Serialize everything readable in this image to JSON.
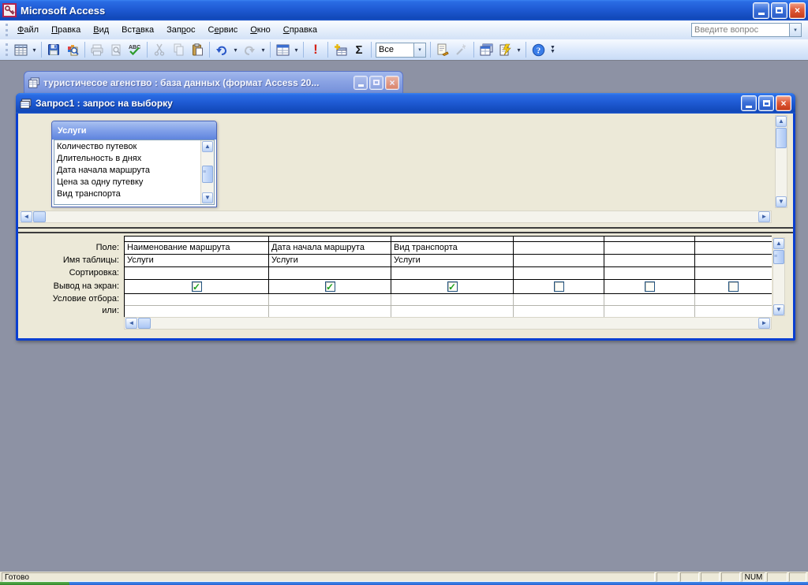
{
  "app": {
    "title": "Microsoft Access"
  },
  "menu": {
    "items": [
      {
        "pre": "",
        "key": "Ф",
        "post": "айл"
      },
      {
        "pre": "",
        "key": "П",
        "post": "равка"
      },
      {
        "pre": "",
        "key": "В",
        "post": "ид"
      },
      {
        "pre": "Вст",
        "key": "а",
        "post": "вка"
      },
      {
        "pre": "Зап",
        "key": "р",
        "post": "ос"
      },
      {
        "pre": "С",
        "key": "е",
        "post": "рвис"
      },
      {
        "pre": "",
        "key": "О",
        "post": "кно"
      },
      {
        "pre": "",
        "key": "С",
        "post": "правка"
      }
    ]
  },
  "question_box": {
    "placeholder": "Введите вопрос"
  },
  "toolbar": {
    "top_values_value": "Все"
  },
  "db_window": {
    "title": "туристичесое агенство : база данных (формат Access 20..."
  },
  "query_window": {
    "title": "Запрос1 : запрос на выборку"
  },
  "field_list": {
    "title": "Услуги",
    "fields": [
      "Количество путевок",
      "Длительность в днях",
      "Дата начала маршрута",
      "Цена за одну путевку",
      "Вид транспорта"
    ]
  },
  "grid": {
    "row_labels": {
      "field": "Поле:",
      "table": "Имя таблицы:",
      "sort": "Сортировка:",
      "show": "Вывод на экран:",
      "criteria": "Условие отбора:",
      "or": "или:"
    },
    "columns": [
      {
        "field": "Наименование маршрута",
        "table": "Услуги",
        "show": true
      },
      {
        "field": "Дата начала маршрута",
        "table": "Услуги",
        "show": true
      },
      {
        "field": "Вид транспорта",
        "table": "Услуги",
        "show": true
      },
      {
        "field": "",
        "table": "",
        "show": false
      },
      {
        "field": "",
        "table": "",
        "show": false
      },
      {
        "field": "",
        "table": "",
        "show": false
      }
    ]
  },
  "status": {
    "ready": "Готово",
    "num": "NUM"
  },
  "icons": {
    "check": "✓",
    "dropdown": "▾",
    "up": "▲",
    "down": "▼",
    "left": "◄",
    "right": "►",
    "close": "×",
    "spell": "ABC",
    "sigma": "Σ",
    "run": "!",
    "help": "?"
  },
  "colors": {
    "titlebar_blue": "#1f5bd4",
    "inactive_title": "#8aa3e4",
    "mdi_bg": "#8d92a4",
    "face": "#ece9d8",
    "query_border": "#0a3fd0",
    "check_green": "#1ea11e"
  }
}
